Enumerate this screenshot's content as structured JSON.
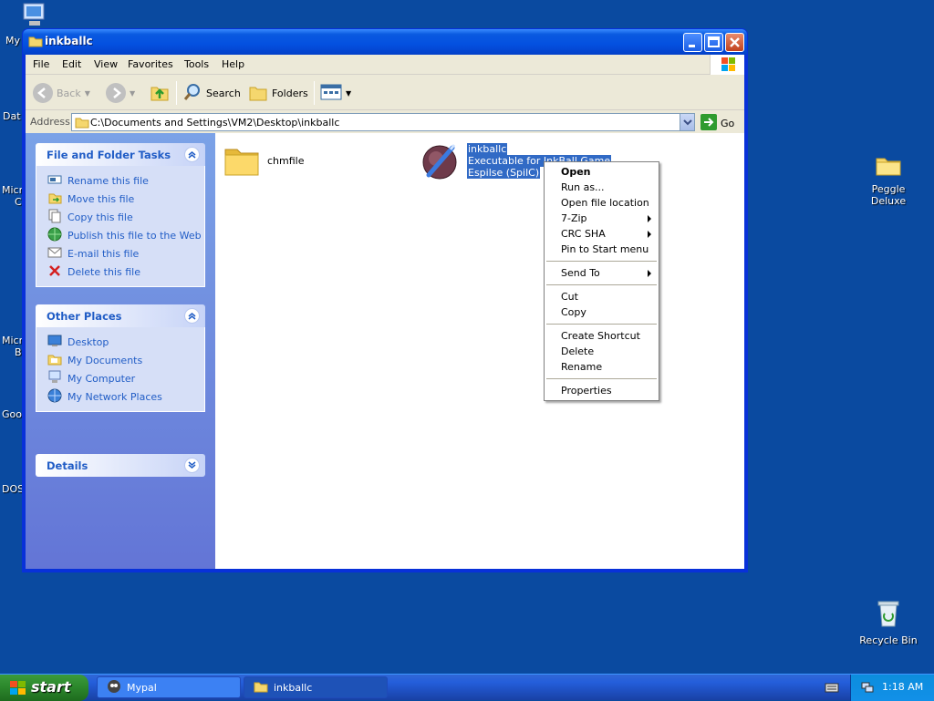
{
  "desktop": {
    "left_labels": [
      "My",
      "Dat",
      "Micr",
      "C",
      "Micr",
      "B",
      "Goo",
      "DOS"
    ],
    "icons": {
      "peggle": "Peggle Deluxe",
      "recycle": "Recycle Bin"
    }
  },
  "window": {
    "title": "inkballc",
    "menu": [
      "File",
      "Edit",
      "View",
      "Favorites",
      "Tools",
      "Help"
    ],
    "toolbar": {
      "back": "Back",
      "search": "Search",
      "folders": "Folders"
    },
    "address": {
      "label": "Address",
      "value": "C:\\Documents and Settings\\VM2\\Desktop\\inkballc",
      "go": "Go"
    }
  },
  "tasks_panel": {
    "title": "File and Folder Tasks",
    "items": [
      "Rename this file",
      "Move this file",
      "Copy this file",
      "Publish this file to the Web",
      "E-mail this file",
      "Delete this file"
    ]
  },
  "places_panel": {
    "title": "Other Places",
    "items": [
      "Desktop",
      "My Documents",
      "My Computer",
      "My Network Places"
    ]
  },
  "details_panel": {
    "title": "Details"
  },
  "files": [
    {
      "name": "chmfile",
      "icon": "folder-icon"
    },
    {
      "name": "inkballc",
      "line2": "Executable for InkBall Game",
      "line3": "Espilse (SpilC)",
      "icon": "inkball-app-icon"
    }
  ],
  "context_menu": {
    "items": [
      "Open",
      "Run as...",
      "Open file location",
      "7-Zip",
      "CRC SHA",
      "Pin to Start menu",
      "Send To",
      "Cut",
      "Copy",
      "Create Shortcut",
      "Delete",
      "Rename",
      "Properties"
    ]
  },
  "taskbar": {
    "start": "start",
    "tasks": [
      "Mypal",
      "inkballc"
    ],
    "clock": "1:18 AM"
  },
  "colors": {
    "desktop": "#0a4aa0",
    "title_blue": "#0450e0",
    "link_blue": "#215dc6",
    "selection": "#316ac5"
  }
}
